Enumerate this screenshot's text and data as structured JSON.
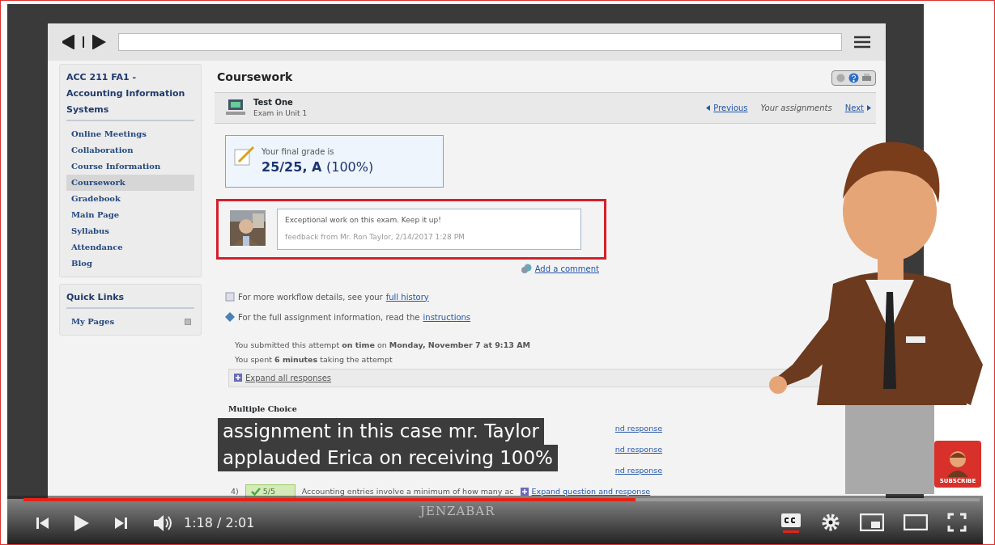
{
  "sidebar": {
    "course_title": "ACC 211 FA1 - Accounting Information Systems",
    "items": [
      {
        "label": "Online Meetings",
        "selected": false
      },
      {
        "label": "Collaboration",
        "selected": false
      },
      {
        "label": "Course Information",
        "selected": false
      },
      {
        "label": "Coursework",
        "selected": true
      },
      {
        "label": "Gradebook",
        "selected": false
      },
      {
        "label": "Main Page",
        "selected": false
      },
      {
        "label": "Syllabus",
        "selected": false
      },
      {
        "label": "Attendance",
        "selected": false
      },
      {
        "label": "Blog",
        "selected": false
      }
    ],
    "quick_links": {
      "title": "Quick Links",
      "items": [
        {
          "label": "My Pages"
        }
      ]
    }
  },
  "content": {
    "title": "Coursework",
    "assignment": {
      "title": "Test One",
      "subtitle": "Exam in Unit 1"
    },
    "nav": {
      "previous": "Previous",
      "assignments": "Your assignments",
      "next": "Next"
    },
    "grade": {
      "label": "Your final grade is",
      "score": "25/25, A",
      "percent": "(100%)"
    },
    "feedback": {
      "message": "Exceptional work on this exam. Keep it up!",
      "byline": "feedback from Mr. Ron Taylor, 2/14/2017 1:28 PM",
      "highlighted": true
    },
    "add_comment": "Add a comment",
    "info_lines": [
      {
        "kind": "history",
        "text": "For more workflow details, see your",
        "link": "full history"
      },
      {
        "kind": "info",
        "text": "For the full assignment information, read the",
        "link": "instructions"
      }
    ],
    "submission": [
      "You submitted this attempt **on time** on **Monday, November 7 at 9:13 AM**",
      "You spent **6 minutes** taking the attempt"
    ],
    "expand_all": "Expand all responses",
    "section": "Multiple Choice",
    "questions": [
      {
        "link": "nd response"
      },
      {
        "link": "nd response"
      },
      {
        "link": "nd response"
      },
      {
        "number": "4)",
        "score": "5/5",
        "text": "Accounting entries involve a minimum of how many ac",
        "link": "Expand question and response"
      }
    ]
  },
  "captions": [
    "assignment in this case mr. Taylor",
    "applauded Erica on receiving 100%"
  ],
  "brand": "JENZABAR",
  "subscribe": "SUBSCRIBE",
  "player": {
    "progress": {
      "level": 0.64
    },
    "time": "1:18 / 2:01",
    "captions_on": true
  }
}
